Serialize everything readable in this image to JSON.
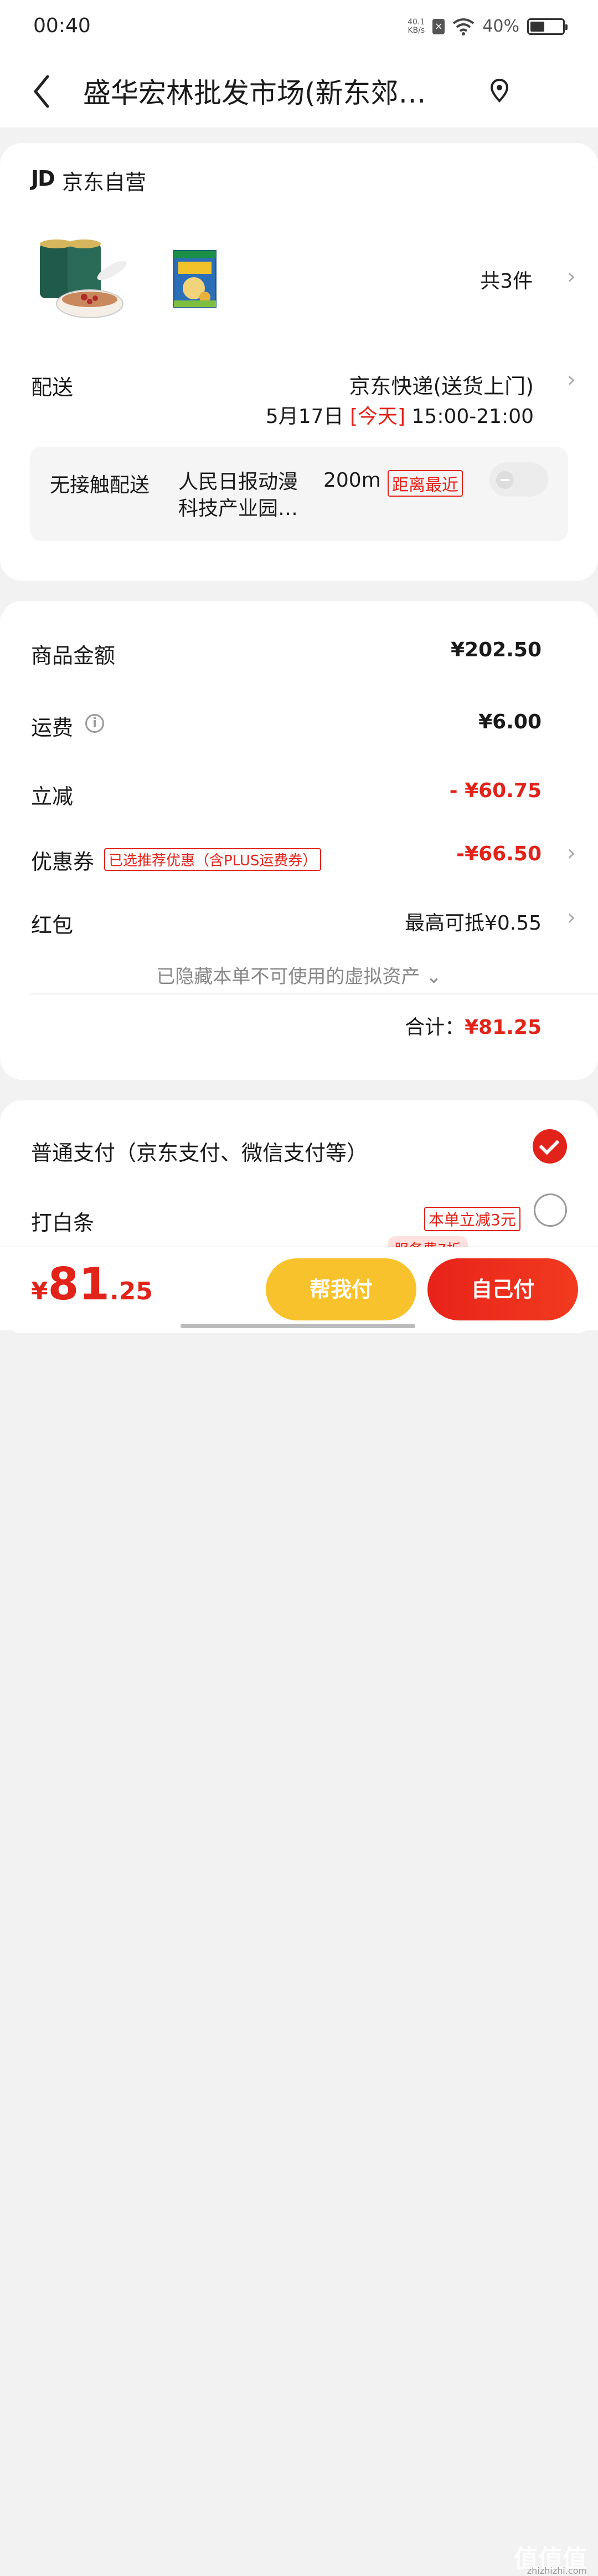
{
  "status_bar": {
    "time": "00:40",
    "net_speed": "40.1",
    "net_unit": "KB/s",
    "battery": "40%"
  },
  "nav": {
    "title": "盛华宏林批发市场(新东郊…"
  },
  "order": {
    "store_logo": "JD",
    "store_name": "京东自营",
    "item_count": "共3件",
    "delivery_label": "配送",
    "delivery_method": "京东快递(送货上门)",
    "delivery_date": "5月17日",
    "delivery_today": "[今天]",
    "delivery_window": "15:00-21:00",
    "contactless_label": "无接触配送",
    "contactless_address": "人民日报动漫科技产业园…",
    "contactless_distance": "200m",
    "contactless_tag": "距离最近"
  },
  "summary": {
    "goods_label": "商品金额",
    "goods_value": "¥202.50",
    "shipping_label": "运费",
    "shipping_value": "¥6.00",
    "discount_label": "立减",
    "discount_value": "- ¥60.75",
    "coupon_label": "优惠券",
    "coupon_tag": "已选推荐优惠（含PLUS运费券）",
    "coupon_value": "-¥66.50",
    "redpacket_label": "红包",
    "redpacket_value": "最高可抵¥0.55",
    "hidden_note": "已隐藏本单不可使用的虚拟资产 ⌄",
    "total_label": "合计：",
    "total_value": "¥81.25"
  },
  "payment": {
    "normal_label": "普通支付（京东支付、微信支付等）",
    "baitiao_label": "打白条",
    "baitiao_tag": "本单立减3元",
    "service_tag": "服务费7折"
  },
  "bottom": {
    "currency": "¥",
    "price_int": "81",
    "price_dec": ".25",
    "help_pay": "帮我付",
    "self_pay": "自己付"
  },
  "watermark": {
    "main": "值值值",
    "sub": "zhizhizhi.com"
  }
}
